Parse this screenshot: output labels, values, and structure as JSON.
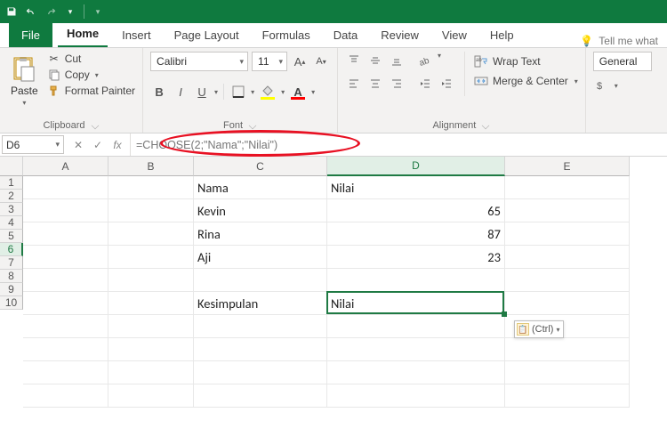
{
  "titlebar": {
    "save_icon": "save",
    "undo_icon": "undo",
    "redo_icon": "redo",
    "customize_icon": "customize"
  },
  "tabs": {
    "file": "File",
    "home": "Home",
    "insert": "Insert",
    "page_layout": "Page Layout",
    "formulas": "Formulas",
    "data": "Data",
    "review": "Review",
    "view": "View",
    "help": "Help",
    "tell_me": "Tell me what",
    "active": "home"
  },
  "ribbon": {
    "clipboard": {
      "paste": "Paste",
      "cut": "Cut",
      "copy": "Copy",
      "format_painter": "Format Painter",
      "label": "Clipboard"
    },
    "font": {
      "name": "Calibri",
      "size": "11",
      "label": "Font",
      "bold": "B",
      "italic": "I",
      "underline": "U",
      "fill_color": "#ffff00",
      "font_color": "#ff0000"
    },
    "alignment": {
      "wrap": "Wrap Text",
      "merge": "Merge & Center",
      "label": "Alignment"
    },
    "number": {
      "format": "General"
    }
  },
  "formula_bar": {
    "name_box": "D6",
    "formula": "=CHOOSE(2;\"Nama\";\"Nilai\")",
    "circled": true
  },
  "grid": {
    "columns": [
      "A",
      "B",
      "C",
      "D",
      "E"
    ],
    "col_widths": {
      "A": 96,
      "B": 96,
      "C": 150,
      "D": 200,
      "E": 140
    },
    "row_count": 10,
    "selected_cell": "D6",
    "selected_col": "D",
    "selected_row": 6,
    "cells": {
      "C1": "Nama",
      "D1": "Nilai",
      "C2": "Kevin",
      "D2": "65",
      "C3": "Rina",
      "D3": "87",
      "C4": "Aji",
      "D4": "23",
      "C6": "Kesimpulan",
      "D6": "Nilai"
    },
    "numeric_cells": [
      "D2",
      "D3",
      "D4"
    ]
  },
  "paste_options": {
    "label": "(Ctrl)"
  }
}
